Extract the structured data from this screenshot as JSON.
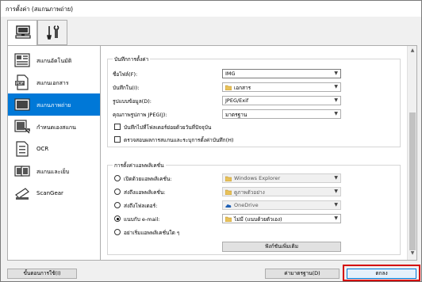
{
  "window": {
    "title": "การตั้งค่า (สแกนภาพถ่าย)"
  },
  "tabs": [
    {
      "name": "scan-from-computer",
      "icon": "computer-icon",
      "active": true
    },
    {
      "name": "general-settings",
      "icon": "tools-icon",
      "active": false
    }
  ],
  "sidebar": {
    "items": [
      {
        "label": "สแกนอัตโนมัติ",
        "icon": "auto-scan-icon",
        "selected": false
      },
      {
        "label": "สแกนเอกสาร",
        "icon": "document-pdf-icon",
        "selected": false
      },
      {
        "label": "สแกนภาพถ่าย",
        "icon": "photo-icon",
        "selected": true
      },
      {
        "label": "กำหนดเองสแกน",
        "icon": "custom-scan-icon",
        "selected": false
      },
      {
        "label": "OCR",
        "icon": "ocr-icon",
        "selected": false
      },
      {
        "label": "สแกนและเย็บ",
        "icon": "stitch-icon",
        "selected": false
      },
      {
        "label": "ScanGear",
        "icon": "scangear-icon",
        "selected": false
      }
    ]
  },
  "save_settings": {
    "group_title": "บันทึกการตั้งค่า",
    "file_name_label": "ชื่อไฟล์(F):",
    "file_name_value": "IMG",
    "save_in_label": "บันทึกใน(I):",
    "save_in_value": "เอกสาร",
    "data_format_label": "รูปแบบข้อมูล(D):",
    "data_format_value": "JPEG/Exif",
    "jpeg_quality_label": "คุณภาพรูปภาพ JPEG(J):",
    "jpeg_quality_value": "มาตรฐาน",
    "checkbox_subfolder_label": "บันทึกไปที่โฟลเดอร์ย่อยด้วยวันที่ปัจจุบัน",
    "checkbox_check_result_label": "ตรวจสอบผลการสแกนและระบุการตั้งค่าบันทึก(H)"
  },
  "app_settings": {
    "group_title": "การตั้งค่าแอพพลิเคชั่น",
    "open_with_label": "เปิดด้วยแอพพลิเคชั่น:",
    "open_with_value": "Windows Explorer",
    "send_to_app_label": "ส่งถึงแอพพลิเคชั่น:",
    "send_to_app_value": "ดูภาพตัวอย่าง",
    "send_to_folder_label": "ส่งถึงโฟลเดอร์:",
    "send_to_folder_value": "OneDrive",
    "attach_email_label": "แนบกับ e-mail:",
    "attach_email_value": "ไม่มี (แนบด้วยตัวเอง)",
    "no_app_label": "อย่าเริ่มแอพพลิเคชั่นใด ๆ",
    "more_functions_label": "ฟังก์ชันเพิ่มเติม",
    "selected_option": "attach_email"
  },
  "footer": {
    "instructions_label": "ขั้นตอนการใช้(I)",
    "defaults_label": "ค่ามาตรฐาน(D)",
    "ok_label": "ตกลง"
  },
  "colors": {
    "selection": "#0078d7",
    "highlight": "#d40000"
  }
}
